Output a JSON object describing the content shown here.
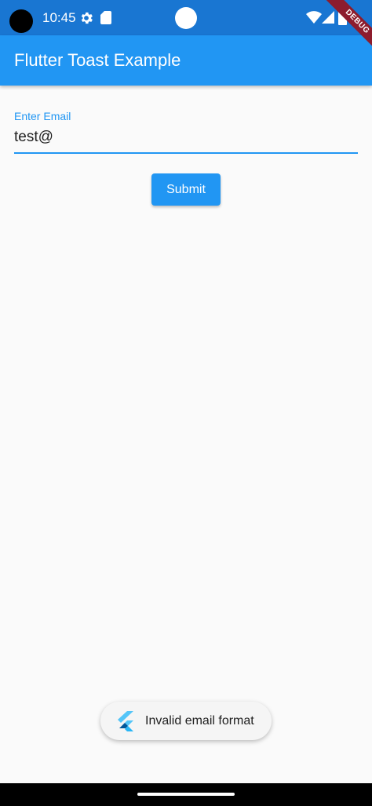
{
  "status_bar": {
    "time": "10:45",
    "icons": [
      "gear-icon",
      "sd-card-icon",
      "wifi-icon",
      "signal-icon",
      "battery-icon"
    ]
  },
  "app_bar": {
    "title": "Flutter Toast Example",
    "color": "#2196f3"
  },
  "debug_banner": {
    "label": "DEBUG"
  },
  "form": {
    "email": {
      "label": "Enter Email",
      "value": "test@"
    },
    "submit_label": "Submit"
  },
  "toast": {
    "icon": "flutter-logo-icon",
    "message": "Invalid email format"
  },
  "colors": {
    "primary": "#2196f3",
    "status_bar": "#1976d2",
    "background": "#fafafa",
    "debug": "#8d1c2d"
  }
}
